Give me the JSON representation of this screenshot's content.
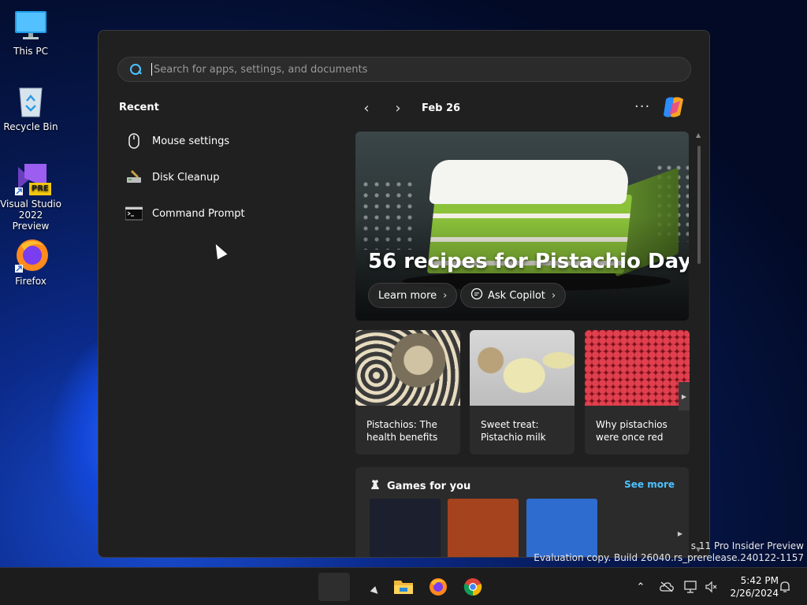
{
  "desktop": {
    "icons": [
      {
        "label": "This PC"
      },
      {
        "label": "Recycle Bin"
      },
      {
        "label": "Visual Studio 2022 Preview",
        "badge": "PRE"
      },
      {
        "label": "Firefox"
      }
    ]
  },
  "search": {
    "placeholder": "Search for apps, settings, and documents",
    "value": ""
  },
  "recent": {
    "title": "Recent",
    "items": [
      {
        "label": "Mouse settings",
        "icon": "mouse-icon"
      },
      {
        "label": "Disk Cleanup",
        "icon": "disk-cleanup-icon"
      },
      {
        "label": "Command Prompt",
        "icon": "command-prompt-icon"
      }
    ]
  },
  "highlights": {
    "date": "Feb 26",
    "more_label": "···",
    "hero": {
      "title": "56 recipes for Pistachio Day",
      "learn_more": "Learn more",
      "ask_copilot": "Ask Copilot"
    },
    "cards": [
      {
        "title": "Pistachios: The health benefits"
      },
      {
        "title": "Sweet treat: Pistachio milk"
      },
      {
        "title": "Why pistachios were once red"
      }
    ],
    "games": {
      "title": "Games for you",
      "see_more": "See more",
      "tile_colors": [
        "#1b1f2e",
        "#a5431f",
        "#2f6ccf"
      ]
    }
  },
  "watermark": {
    "line1": "s 11 Pro Insider Preview",
    "line2": "Evaluation copy. Build 26040.rs_prerelease.240122-1157"
  },
  "taskbar": {
    "time": "5:42 PM",
    "date": "2/26/2024"
  },
  "colors": {
    "accent": "#4cc2ff",
    "panel": "#202020",
    "card": "#2b2b2b"
  }
}
